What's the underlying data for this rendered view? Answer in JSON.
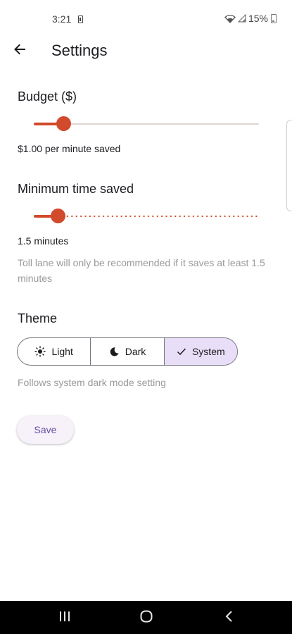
{
  "status_bar": {
    "time": "3:21",
    "battery_percent": "15%",
    "icons": [
      "battery-saver-icon",
      "wifi-icon",
      "signal-icon",
      "battery-icon"
    ]
  },
  "app_bar": {
    "title": "Settings",
    "back_icon": "arrow-back-icon"
  },
  "budget": {
    "title": "Budget ($)",
    "value_text": "$1.00 per minute saved",
    "slider_fraction": 0.13
  },
  "min_time": {
    "title": "Minimum time saved",
    "value_text": "1.5 minutes",
    "help_text": "Toll lane will only be recommended if it saves at least 1.5 minutes",
    "slider_fraction": 0.105
  },
  "theme": {
    "title": "Theme",
    "options": [
      {
        "label": "Light",
        "icon": "sun-icon",
        "selected": false
      },
      {
        "label": "Dark",
        "icon": "moon-icon",
        "selected": false
      },
      {
        "label": "System",
        "icon": "check-icon",
        "selected": true
      }
    ],
    "help_text": "Follows system dark mode setting"
  },
  "save_button": {
    "label": "Save"
  },
  "colors": {
    "accent": "#d14a2b",
    "selected_segment": "#e8def8",
    "button_text": "#6750a4"
  },
  "nav_bar": {
    "icons": [
      "recents-icon",
      "home-icon",
      "back-icon"
    ]
  }
}
